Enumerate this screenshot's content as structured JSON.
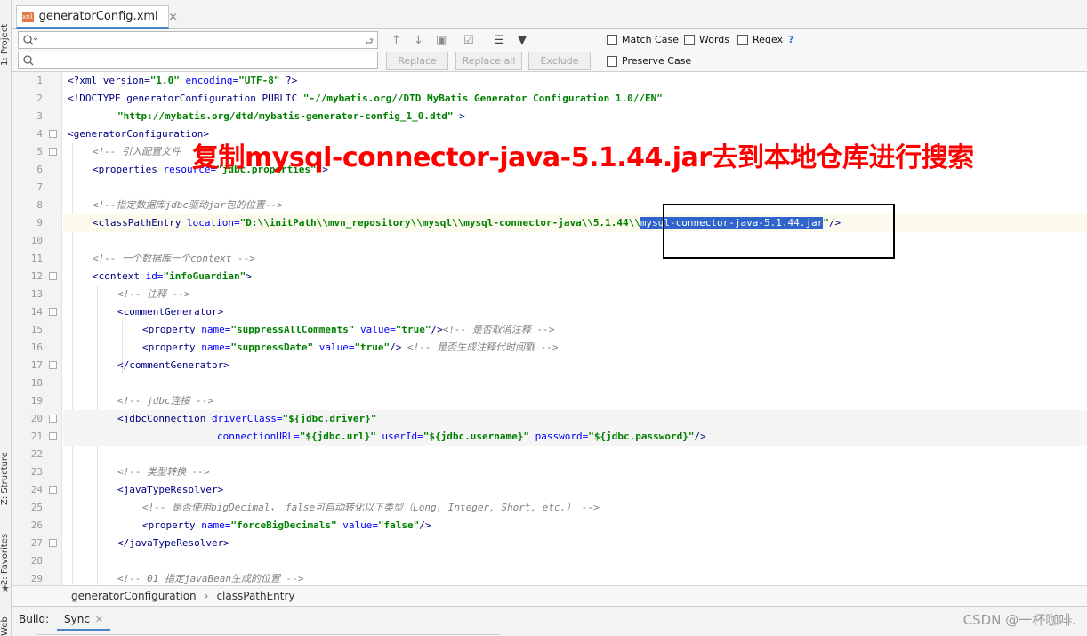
{
  "left_strip": {
    "project": "1: Project",
    "structure": "Z: Structure",
    "favorites": "2: Favorites",
    "web": "Web"
  },
  "tab": {
    "title": "generatorConfig.xml",
    "icon": "xml"
  },
  "find": {
    "search_value": "",
    "replace_value": "",
    "buttons": {
      "replace": "Replace",
      "replace_all": "Replace all",
      "exclude": "Exclude"
    },
    "options": {
      "match_case": "Match Case",
      "words": "Words",
      "regex": "Regex",
      "help": "?",
      "preserve_case": "Preserve Case"
    }
  },
  "editor": {
    "lines": [
      {
        "n": "1"
      },
      {
        "n": "2"
      },
      {
        "n": "3"
      },
      {
        "n": "4"
      },
      {
        "n": "5"
      },
      {
        "n": "6"
      },
      {
        "n": "7"
      },
      {
        "n": "8"
      },
      {
        "n": "9"
      },
      {
        "n": "10"
      },
      {
        "n": "11"
      },
      {
        "n": "12"
      },
      {
        "n": "13"
      },
      {
        "n": "14"
      },
      {
        "n": "15"
      },
      {
        "n": "16"
      },
      {
        "n": "17"
      },
      {
        "n": "18"
      },
      {
        "n": "19"
      },
      {
        "n": "20"
      },
      {
        "n": "21"
      },
      {
        "n": "22"
      },
      {
        "n": "23"
      },
      {
        "n": "24"
      },
      {
        "n": "25"
      },
      {
        "n": "26"
      },
      {
        "n": "27"
      },
      {
        "n": "28"
      },
      {
        "n": "29"
      }
    ],
    "t": {
      "l1_a": "<?xml version=",
      "l1_b": "\"1.0\"",
      "l1_c": " encoding=",
      "l1_d": "\"UTF-8\"",
      "l1_e": " ?>",
      "l2_a": "<!DOCTYPE generatorConfiguration PUBLIC ",
      "l2_b": "\"-//mybatis.org//DTD MyBatis Generator Configuration 1.0//EN\"",
      "l3_a": "\"http://mybatis.org/dtd/mybatis-generator-config_1_0.dtd\"",
      "l3_b": " >",
      "l4": "<generatorConfiguration>",
      "l5": "<!-- 引入配置文件",
      "l6_a": "<properties ",
      "l6_b": "resource=",
      "l6_c": "\"jdbc.properties\"",
      "l6_d": "/>",
      "l8": "<!--指定数据库jdbc驱动jar包的位置-->",
      "l9_a": "<classPathEntry ",
      "l9_b": "location=",
      "l9_c": "\"D:\\\\initPath\\\\mvn_repository\\\\mysql\\\\mysql-connector-java\\\\5.1.44\\\\",
      "l9_sel": "mysql-connector-java-5.1.44.jar",
      "l9_d": "\"",
      "l9_e": "/>",
      "l11": "<!-- 一个数据库一个context -->",
      "l12_a": "<context ",
      "l12_b": "id=",
      "l12_c": "\"infoGuardian\"",
      "l12_d": ">",
      "l13": "<!-- 注释 -->",
      "l14": "<commentGenerator>",
      "l15_a": "<property ",
      "l15_b": "name=",
      "l15_c": "\"suppressAllComments\"",
      "l15_d": " value=",
      "l15_e": "\"true\"",
      "l15_f": "/>",
      "l15_g": "<!-- 是否取消注释 -->",
      "l16_a": "<property ",
      "l16_b": "name=",
      "l16_c": "\"suppressDate\"",
      "l16_d": " value=",
      "l16_e": "\"true\"",
      "l16_f": "/>",
      "l16_g": " <!-- 是否生成注释代时间戳 -->",
      "l17": "</commentGenerator>",
      "l19": "<!-- jdbc连接 -->",
      "l20_a": "<jdbcConnection ",
      "l20_b": "driverClass=",
      "l20_c": "\"${jdbc.driver}\"",
      "l21_a": "connectionURL=",
      "l21_b": "\"${jdbc.url}\"",
      "l21_c": " userId=",
      "l21_d": "\"${jdbc.username}\"",
      "l21_e": " password=",
      "l21_f": "\"${jdbc.password}\"",
      "l21_g": "/>",
      "l23": "<!-- 类型转换 -->",
      "l24": "<javaTypeResolver>",
      "l25": "<!-- 是否使用bigDecimal， false可自动转化以下类型（Long, Integer, Short, etc.） -->",
      "l26_a": "<property ",
      "l26_b": "name=",
      "l26_c": "\"forceBigDecimals\"",
      "l26_d": " value=",
      "l26_e": "\"false\"",
      "l26_f": "/>",
      "l27": "</javaTypeResolver>",
      "l29": "<!-- 01 指定javaBean生成的位置 -->"
    }
  },
  "annotation": "复制mysql-connector-java-5.1.44.jar去到本地仓库进行搜索",
  "breadcrumb": {
    "item1": "generatorConfiguration",
    "sep": "›",
    "item2": "classPathEntry"
  },
  "build": {
    "label": "Build:",
    "sync": "Sync"
  },
  "watermark": "CSDN @一杯咖啡."
}
